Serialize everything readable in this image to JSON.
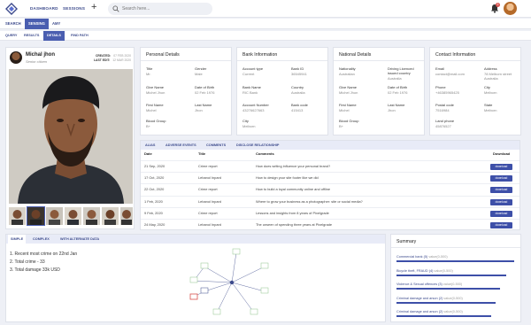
{
  "nav": {
    "links": [
      "DASHBOARD",
      "SESSIONS"
    ],
    "search_placeholder": "Search here...",
    "notification_count": "2"
  },
  "tabs_primary": [
    "SEARCH",
    "SENSING",
    "AMY"
  ],
  "tabs_primary_active": 1,
  "tabs_secondary": [
    "QUERY",
    "RESULTS",
    "DETAILS",
    "FIND PATH"
  ],
  "tabs_secondary_active": 2,
  "profile": {
    "name": "Michal jhon",
    "subtitle": "Senior citizen",
    "created_label": "CREATED:",
    "created_value": "07 FEB 2020",
    "last_edit_label": "LAST EDIT:",
    "last_edit_value": "12 MAR 2020"
  },
  "personal": {
    "title": "Personal Details",
    "fields": [
      {
        "k": "Title",
        "v": "Mr."
      },
      {
        "k": "Gender",
        "v": "Male"
      },
      {
        "k": "Give Name",
        "v": "Michel Jhon"
      },
      {
        "k": "Date of Birth",
        "v": "02 Feb 1976"
      },
      {
        "k": "First Name",
        "v": "Michel"
      },
      {
        "k": "Last Name",
        "v": "Jhon"
      },
      {
        "k": "Blood Group",
        "v": "B+"
      }
    ]
  },
  "bank": {
    "title": "Bank Information",
    "fields": [
      {
        "k": "Account type",
        "v": "Current"
      },
      {
        "k": "Bank ID",
        "v": "36545941"
      },
      {
        "k": "Bank Name",
        "v": "RIC Bank"
      },
      {
        "k": "Country",
        "v": "Australia"
      },
      {
        "k": "Account Number",
        "v": "43276627663"
      },
      {
        "k": "Bank code",
        "v": "415413"
      },
      {
        "k": "City",
        "v": "Melborn"
      }
    ]
  },
  "national": {
    "title": "National Details",
    "fields": [
      {
        "k": "Nationality",
        "v": "Australian"
      },
      {
        "k": "Driving Licenced issued country",
        "v": "Australia"
      },
      {
        "k": "Give Name",
        "v": "Michel Jhon"
      },
      {
        "k": "Date of Birth",
        "v": "02 Feb 1976"
      },
      {
        "k": "First Name",
        "v": "Michel"
      },
      {
        "k": "Last Name",
        "v": "Jhon"
      },
      {
        "k": "Blood Group",
        "v": "B+"
      }
    ]
  },
  "contact": {
    "title": "Contact Information",
    "fields": [
      {
        "k": "Email",
        "v": "contact@mail.com"
      },
      {
        "k": "Address",
        "v": "78 Melborn street Australia"
      },
      {
        "k": "Phone",
        "v": "+46385965425"
      },
      {
        "k": "City",
        "v": "Melborn"
      },
      {
        "k": "Postal code",
        "v": "7516984"
      },
      {
        "k": "State",
        "v": "Melborn"
      },
      {
        "k": "Land phone",
        "v": "45876527"
      }
    ]
  },
  "table": {
    "tabs": [
      "ALIAS",
      "ADVERSE EVENTS",
      "COMMENTS",
      "DISCLOSE RELATIONSHIP"
    ],
    "headers": [
      "Date",
      "Title",
      "Comments",
      "Download"
    ],
    "download_label": "download",
    "rows": [
      {
        "date": "21 Sep, 2020",
        "title": "Crime report",
        "comment": "How does writing influence your personal brand?"
      },
      {
        "date": "17 Oct, 2020",
        "title": "Lebanol Inpard",
        "comment": "How to design your site footer like we did"
      },
      {
        "date": "22 Oct, 2020",
        "title": "Crime report",
        "comment": "How to build a loyal community online and offline"
      },
      {
        "date": "1 Feb, 2020",
        "title": "Lebanol Inpard",
        "comment": "Where to grow your business as a photographer: site or social media?"
      },
      {
        "date": "9 Feb, 2020",
        "title": "Crime report",
        "comment": "Lessons and insights from 8 years of Pixelgrade"
      },
      {
        "date": "24 May, 2020",
        "title": "Lebanol Inpard",
        "comment": "The unseen of spending three years at Pixelgrade"
      }
    ]
  },
  "graph": {
    "tabs": [
      "SIMPLE",
      "COMPLEX",
      "WITH ALTERNATE DATA"
    ],
    "lines": [
      "1. Recent most crime on 22nd Jan",
      "2. Total crime - 33",
      "3. Total damage 33k USD"
    ]
  },
  "summary": {
    "title": "Summary",
    "items": [
      {
        "label": "Commercial bank (5)",
        "value": "value(0-500)",
        "fraction": 0.98
      },
      {
        "label": "Bicycle theft, FRAUD (4)",
        "value": "value(0-500)",
        "fraction": 0.91
      },
      {
        "label": "Violence & Sexual offences (3)",
        "value": "value(0-500)",
        "fraction": 0.86
      },
      {
        "label": "Criminal damage and arson (2)",
        "value": "value(0-500)",
        "fraction": 0.82
      },
      {
        "label": "Criminal damage and arson (2)",
        "value": "value(0-500)",
        "fraction": 0.79
      }
    ]
  }
}
